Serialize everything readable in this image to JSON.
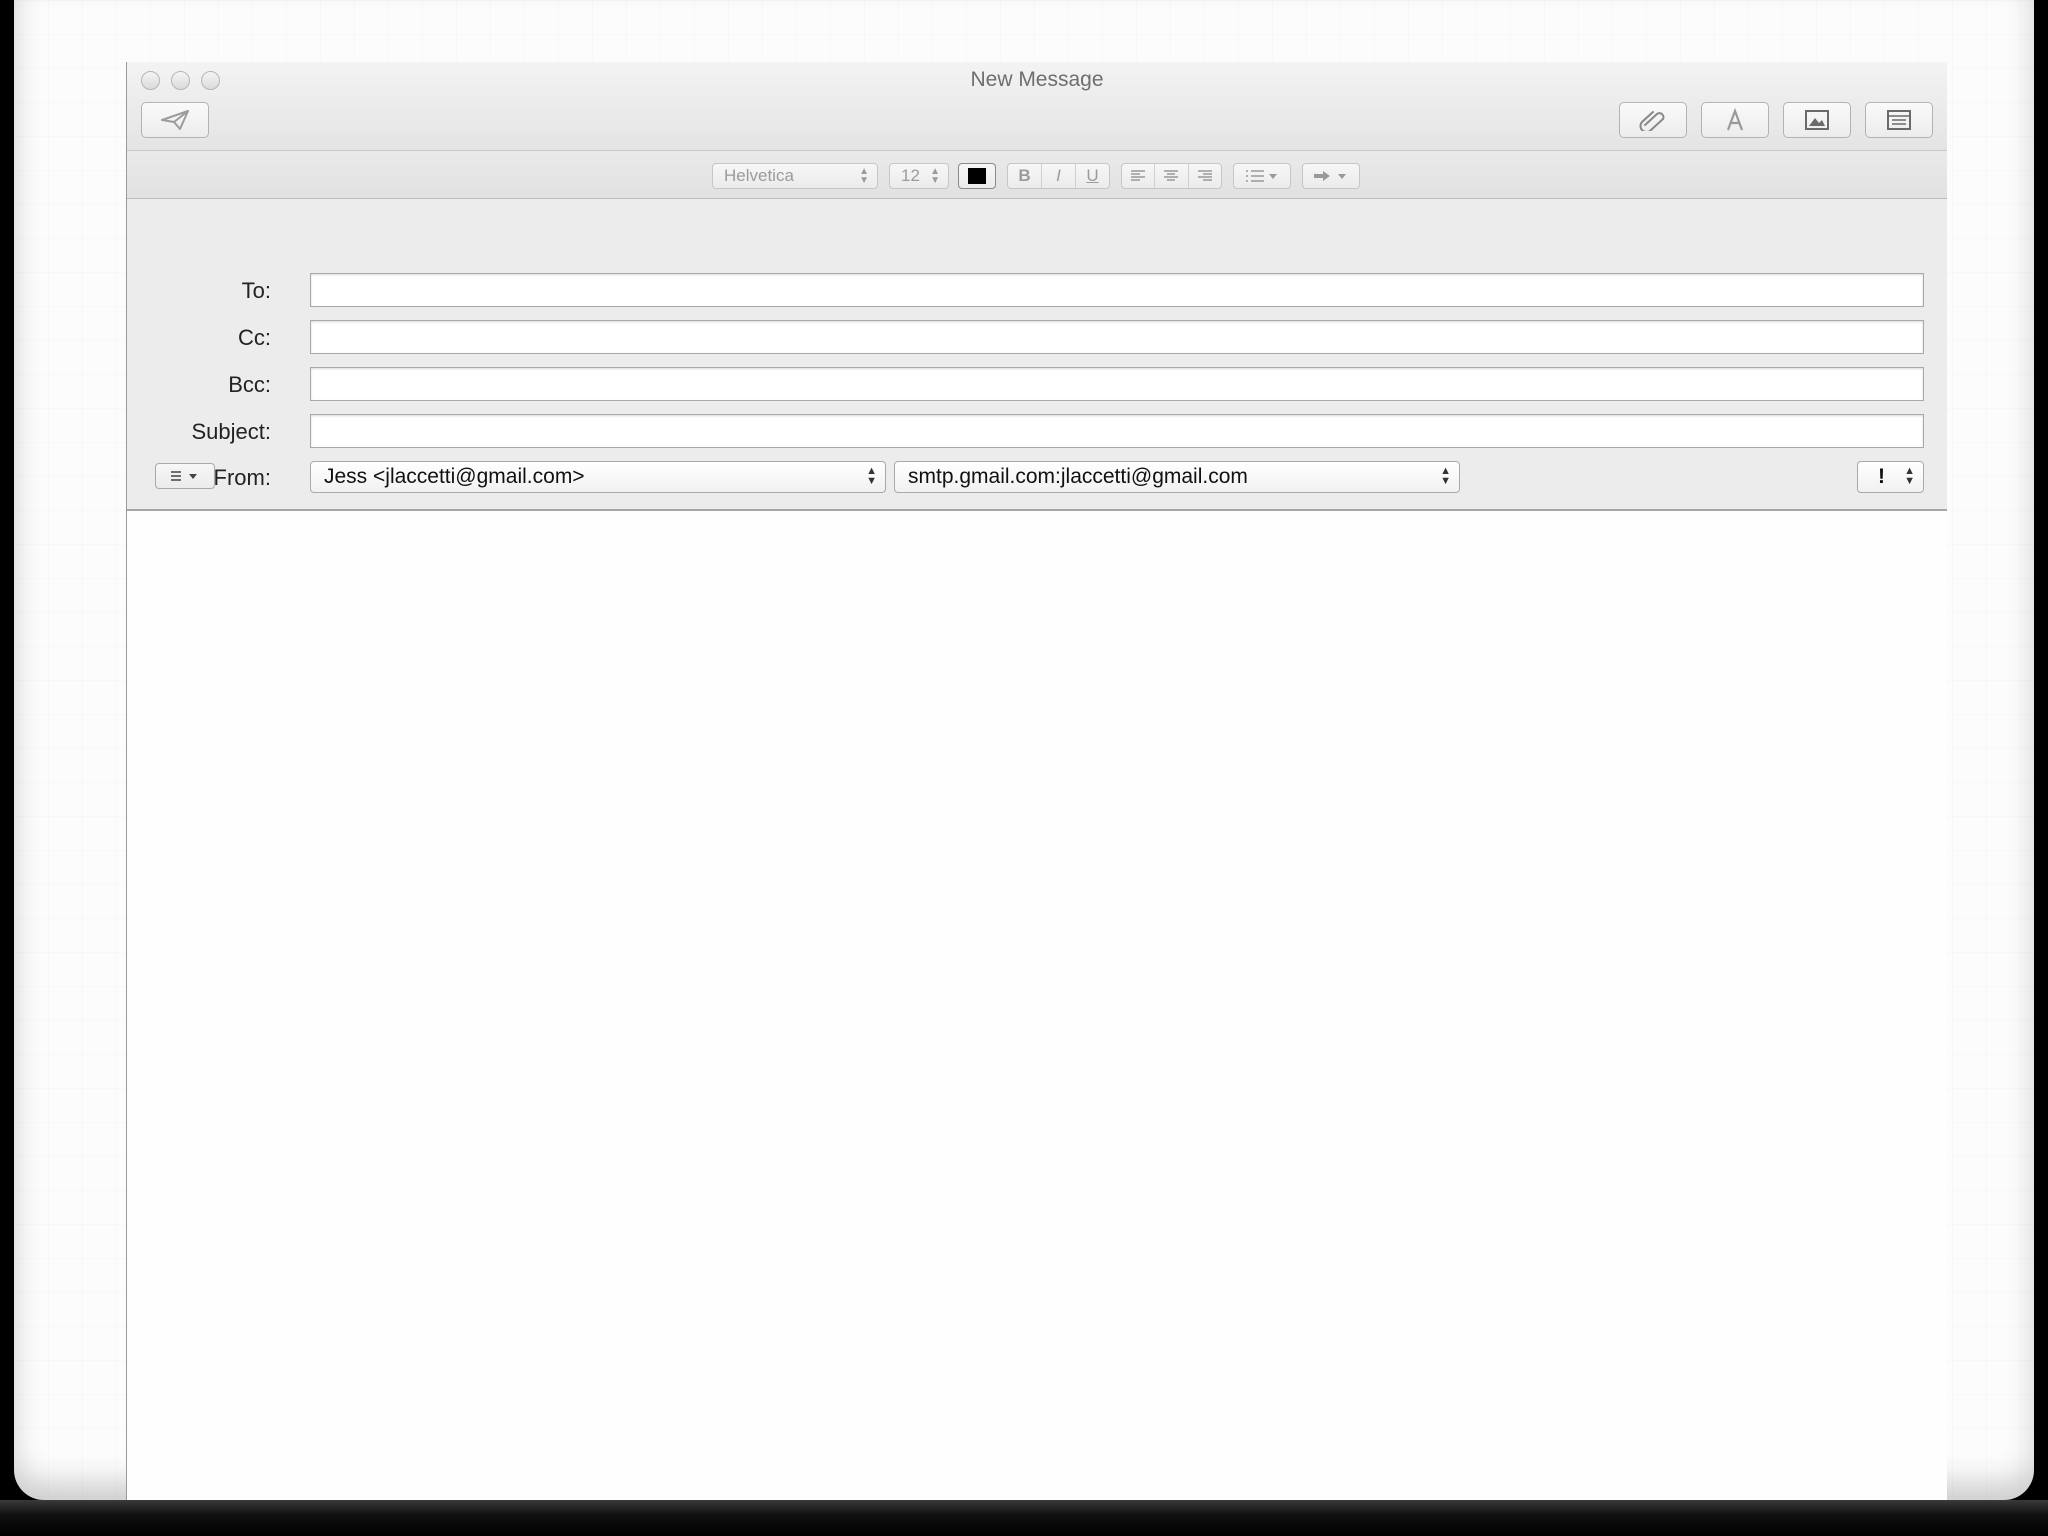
{
  "window": {
    "title": "New Message"
  },
  "toolbar": {
    "send_icon": "paper-plane-icon",
    "attach_icon": "paperclip-icon",
    "fonts_icon": "letter-a-icon",
    "photo_icon": "photo-browser-icon",
    "template_icon": "stationery-icon"
  },
  "format_bar": {
    "font_name": "Helvetica",
    "font_size": "12",
    "text_color": "#000000",
    "bold": "B",
    "italic": "I",
    "underline": "U"
  },
  "header_fields": {
    "to_label": "To:",
    "cc_label": "Cc:",
    "bcc_label": "Bcc:",
    "subject_label": "Subject:",
    "from_label": "From:",
    "to_value": "",
    "cc_value": "",
    "bcc_value": "",
    "subject_value": "",
    "from_value": "Jess <jlaccetti@gmail.com>",
    "smtp_value": "smtp.gmail.com:jlaccetti@gmail.com",
    "priority_value": "!"
  },
  "message_body": ""
}
